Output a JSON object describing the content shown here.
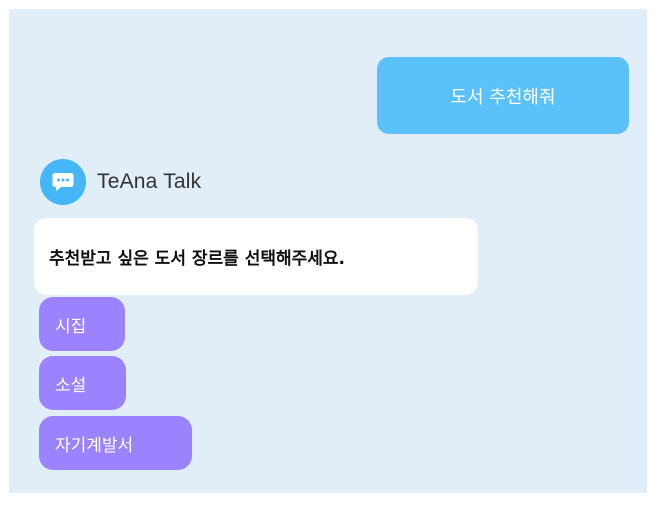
{
  "user_message": {
    "text": "도서 추천해줘"
  },
  "bot": {
    "name": "TeAna Talk",
    "avatar_icon": "chat-bubble-icon",
    "message": "추천받고 싶은 도서 장르를 선택해주세요."
  },
  "options": [
    {
      "label": "시집"
    },
    {
      "label": "소설"
    },
    {
      "label": "자기계발서"
    }
  ],
  "colors": {
    "background": "#e1edf7",
    "user_bubble": "#5bc1fb",
    "bot_avatar": "#45b6f7",
    "option_button": "#9b83ff"
  }
}
